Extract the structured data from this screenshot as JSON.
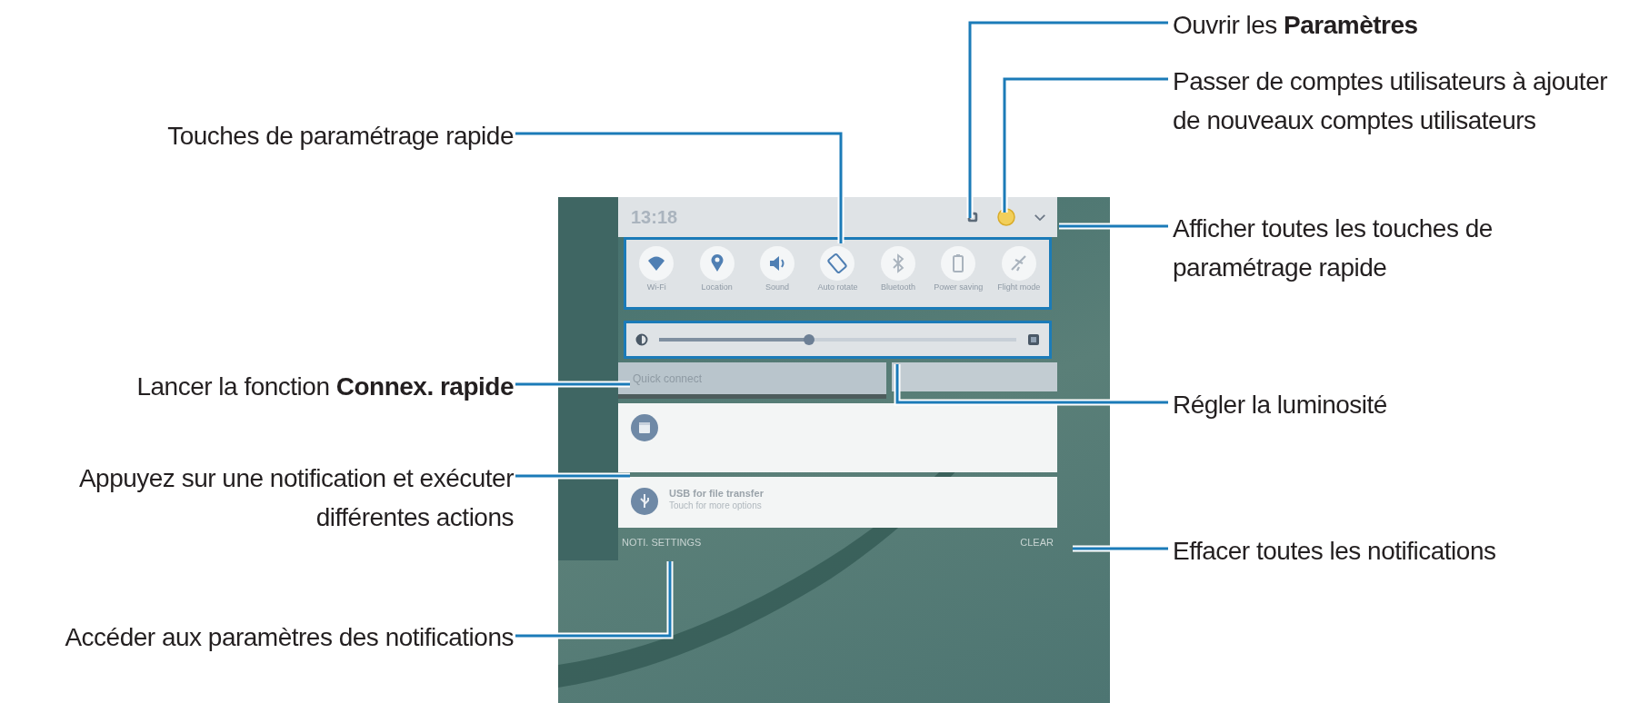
{
  "callouts": [
    {
      "text": "Touches de paramétrage rapide"
    },
    {
      "text": "Ouvrir les **Paramètres**"
    },
    {
      "text": "Passer de comptes utilisateurs à ajouter de nouveaux comptes utilisateurs"
    },
    {
      "text": "Afficher toutes les touches de paramétrage rapide"
    },
    {
      "text": "Lancer la fonction **Connex. rapide**"
    },
    {
      "text": "Régler la luminosité"
    },
    {
      "text": "Appuyez sur une notification et exécuter différentes actions"
    },
    {
      "text": "Effacer toutes les notifications"
    },
    {
      "text": "Accéder aux paramètres des notifications"
    }
  ],
  "panel": {
    "time": "13:18",
    "quick_settings": [
      {
        "kind": "wifi",
        "label": "Wi-Fi",
        "on": true
      },
      {
        "kind": "location",
        "label": "Location",
        "on": true
      },
      {
        "kind": "sound",
        "label": "Sound",
        "on": true
      },
      {
        "kind": "rotate",
        "label": "Auto rotate",
        "on": true
      },
      {
        "kind": "bluetooth",
        "label": "Bluetooth",
        "on": false
      },
      {
        "kind": "power",
        "label": "Power saving",
        "on": false
      },
      {
        "kind": "flight",
        "label": "Flight mode",
        "on": false
      }
    ],
    "brightness": {
      "level": 0.42
    },
    "quick_connect": "Quick connect",
    "notifications": [
      {
        "kind": "calendar"
      },
      {
        "kind": "usb",
        "title": "USB for file transfer",
        "subtitle": "Touch for more options"
      }
    ],
    "noti_settings": "NOTI. SETTINGS",
    "clear": "CLEAR"
  }
}
